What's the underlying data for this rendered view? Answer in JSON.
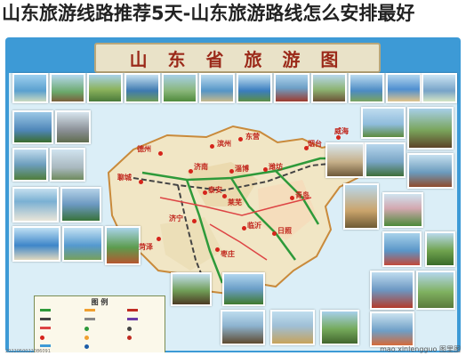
{
  "page": {
    "title": "山东旅游线路推荐5天-山东旅游路线怎么安排最好"
  },
  "map": {
    "banner_title": "山 东 省 旅 游 图",
    "cities": [
      {
        "name": "东营"
      },
      {
        "name": "滨州"
      },
      {
        "name": "德州"
      },
      {
        "name": "聊城"
      },
      {
        "name": "济南"
      },
      {
        "name": "淄博"
      },
      {
        "name": "潍坊"
      },
      {
        "name": "烟台"
      },
      {
        "name": "威海"
      },
      {
        "name": "泰安"
      },
      {
        "name": "莱芜"
      },
      {
        "name": "青岛"
      },
      {
        "name": "济宁"
      },
      {
        "name": "临沂"
      },
      {
        "name": "日照"
      },
      {
        "name": "枣庄"
      },
      {
        "name": "菏泽"
      }
    ],
    "legend": {
      "title": "图 例"
    },
    "colors": {
      "board": "#3d9ad6",
      "province_fill": "#f1e6c5",
      "highway": "#2e9a3a",
      "railway": "#444444",
      "city_marker": "#d5241b"
    }
  },
  "footer": {
    "code": "2022050022086091",
    "watermark": "mao.xinlengguo 图里图"
  }
}
